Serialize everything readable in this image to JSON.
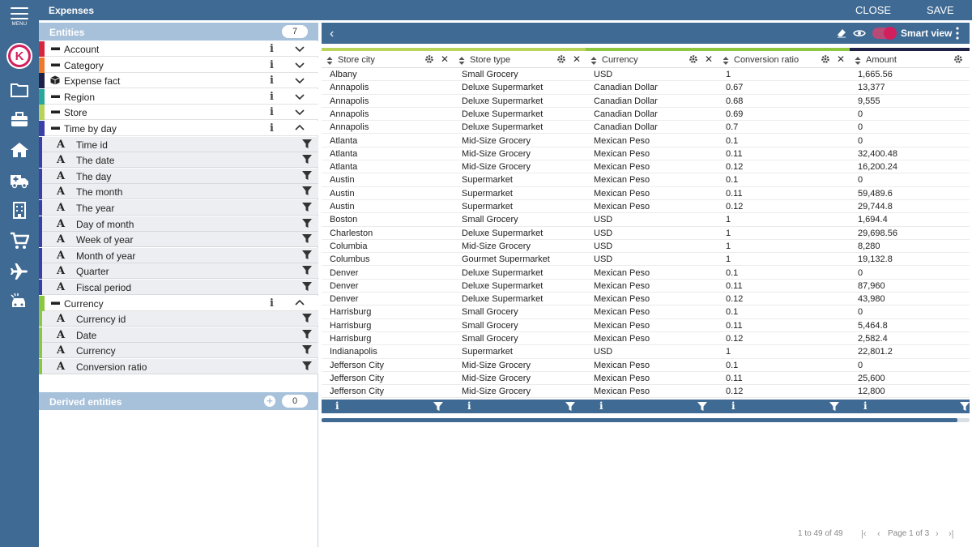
{
  "app": {
    "title": "Expenses",
    "menu_label": "MENU",
    "close_label": "CLOSE",
    "save_label": "SAVE"
  },
  "rail_icons": [
    "folder-icon",
    "briefcase-icon",
    "home-icon",
    "ambulance-icon",
    "building-icon",
    "cart-icon",
    "airplane-icon",
    "car-icon"
  ],
  "entities": {
    "title": "Entities",
    "count": "7",
    "items": [
      {
        "label": "Account",
        "color": "#d7263d",
        "kind": "dimension",
        "expanded": false
      },
      {
        "label": "Category",
        "color": "#f07a2b",
        "kind": "dimension",
        "expanded": false
      },
      {
        "label": "Expense fact",
        "color": "#1e2147",
        "kind": "fact",
        "expanded": false
      },
      {
        "label": "Region",
        "color": "#2aa79b",
        "kind": "dimension",
        "expanded": false
      },
      {
        "label": "Store",
        "color": "#b7d35a",
        "kind": "dimension",
        "expanded": false
      },
      {
        "label": "Time by day",
        "color": "#3b3fa8",
        "kind": "dimension",
        "expanded": true,
        "attributes": [
          "Time id",
          "The date",
          "The day",
          "The month",
          "The year",
          "Day of month",
          "Week of year",
          "Month of year",
          "Quarter",
          "Fiscal period"
        ]
      },
      {
        "label": "Currency",
        "color": "#8dc63f",
        "kind": "dimension",
        "expanded": true,
        "attributes": [
          "Currency id",
          "Date",
          "Currency",
          "Conversion ratio"
        ]
      }
    ]
  },
  "derived": {
    "title": "Derived entities",
    "count": "0"
  },
  "toolbar": {
    "smart_view_label": "Smart view"
  },
  "table": {
    "columns": [
      {
        "label": "Store city",
        "color": "#b7d35a"
      },
      {
        "label": "Store type",
        "color": "#b7d35a"
      },
      {
        "label": "Currency",
        "color": "#8dc63f"
      },
      {
        "label": "Conversion ratio",
        "color": "#8dc63f"
      },
      {
        "label": "Amount",
        "color": "#1e2147"
      }
    ],
    "rows": [
      [
        "Albany",
        "Small Grocery",
        "USD",
        "1",
        "1,665.56"
      ],
      [
        "Annapolis",
        "Deluxe Supermarket",
        "Canadian Dollar",
        "0.67",
        "13,377"
      ],
      [
        "Annapolis",
        "Deluxe Supermarket",
        "Canadian Dollar",
        "0.68",
        "9,555"
      ],
      [
        "Annapolis",
        "Deluxe Supermarket",
        "Canadian Dollar",
        "0.69",
        "0"
      ],
      [
        "Annapolis",
        "Deluxe Supermarket",
        "Canadian Dollar",
        "0.7",
        "0"
      ],
      [
        "Atlanta",
        "Mid-Size Grocery",
        "Mexican Peso",
        "0.1",
        "0"
      ],
      [
        "Atlanta",
        "Mid-Size Grocery",
        "Mexican Peso",
        "0.11",
        "32,400.48"
      ],
      [
        "Atlanta",
        "Mid-Size Grocery",
        "Mexican Peso",
        "0.12",
        "16,200.24"
      ],
      [
        "Austin",
        "Supermarket",
        "Mexican Peso",
        "0.1",
        "0"
      ],
      [
        "Austin",
        "Supermarket",
        "Mexican Peso",
        "0.11",
        "59,489.6"
      ],
      [
        "Austin",
        "Supermarket",
        "Mexican Peso",
        "0.12",
        "29,744.8"
      ],
      [
        "Boston",
        "Small Grocery",
        "USD",
        "1",
        "1,694.4"
      ],
      [
        "Charleston",
        "Deluxe Supermarket",
        "USD",
        "1",
        "29,698.56"
      ],
      [
        "Columbia",
        "Mid-Size Grocery",
        "USD",
        "1",
        "8,280"
      ],
      [
        "Columbus",
        "Gourmet Supermarket",
        "USD",
        "1",
        "19,132.8"
      ],
      [
        "Denver",
        "Deluxe Supermarket",
        "Mexican Peso",
        "0.1",
        "0"
      ],
      [
        "Denver",
        "Deluxe Supermarket",
        "Mexican Peso",
        "0.11",
        "87,960"
      ],
      [
        "Denver",
        "Deluxe Supermarket",
        "Mexican Peso",
        "0.12",
        "43,980"
      ],
      [
        "Harrisburg",
        "Small Grocery",
        "Mexican Peso",
        "0.1",
        "0"
      ],
      [
        "Harrisburg",
        "Small Grocery",
        "Mexican Peso",
        "0.11",
        "5,464.8"
      ],
      [
        "Harrisburg",
        "Small Grocery",
        "Mexican Peso",
        "0.12",
        "2,582.4"
      ],
      [
        "Indianapolis",
        "Supermarket",
        "USD",
        "1",
        "22,801.2"
      ],
      [
        "Jefferson City",
        "Mid-Size Grocery",
        "Mexican Peso",
        "0.1",
        "0"
      ],
      [
        "Jefferson City",
        "Mid-Size Grocery",
        "Mexican Peso",
        "0.11",
        "25,600"
      ],
      [
        "Jefferson City",
        "Mid-Size Grocery",
        "Mexican Peso",
        "0.12",
        "12,800"
      ]
    ]
  },
  "pager": {
    "range_text": "1 to 49 of 49",
    "page_text": "Page 1 of 3"
  },
  "colors": {
    "primary": "#3f6a93",
    "header_light": "#a8c1da",
    "accent": "#d21f5d"
  }
}
